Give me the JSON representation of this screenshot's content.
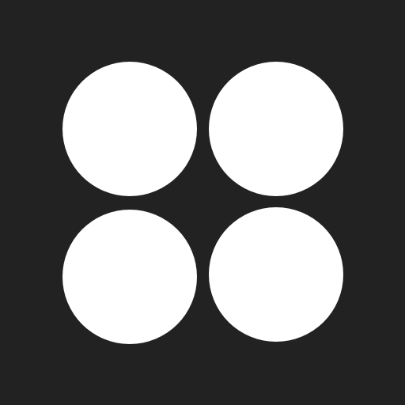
{
  "icon": {
    "name": "four-dots-grid-icon",
    "background_color": "#222222",
    "dot_color": "#ffffff",
    "dots": [
      {
        "name": "dot-top-left"
      },
      {
        "name": "dot-top-right"
      },
      {
        "name": "dot-bottom-left"
      },
      {
        "name": "dot-bottom-right"
      }
    ]
  }
}
